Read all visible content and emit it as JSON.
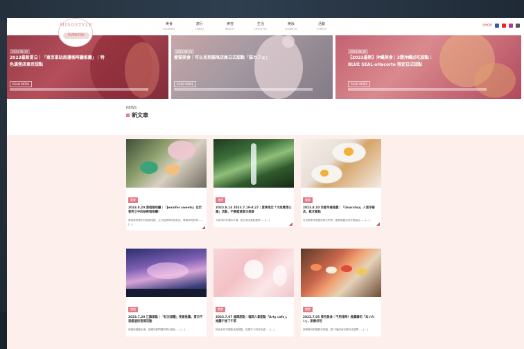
{
  "site": {
    "logo_text": "MISOSTYLE",
    "logo_sub": "EVERYDA",
    "nav": [
      {
        "label": "美食",
        "sub": "GOURMET"
      },
      {
        "label": "旅行",
        "sub": "TRAVEL"
      },
      {
        "label": "美容",
        "sub": "BEAUTY"
      },
      {
        "label": "生活",
        "sub": "LIFESTYLE"
      },
      {
        "label": "美妝",
        "sub": "COSMETIC"
      },
      {
        "label": "活動",
        "sub": "EVENTS"
      }
    ],
    "social_label": "SHOP"
  },
  "slider": {
    "slides": [
      {
        "tag": "2023.08.10",
        "title": "2023最新夏日｜「東京車站周邊咖啡廳推薦」｜特色漢堡店東京甜點",
        "more": "READ MORE"
      },
      {
        "tag": "2023.08.10",
        "title": "愛猫美食｜可以見到貓咪店員日式甜點「猫カフェ」",
        "more": "READ MORE"
      },
      {
        "tag": "2023.08.10",
        "title": "【2023最新】沖縄美食｜3間沖縄必吃甜點｜BLUE SEAL‧oHacorte 限定日式甜點",
        "more": "READ MORE"
      }
    ]
  },
  "news": {
    "eyebrow": "NEWS",
    "title": "新文章",
    "cards": [
      {
        "category": "美食",
        "title": "2023.8.20 原宿咖啡廳｜「Jennifer sweets」位於巷弄之中的秘密咖啡廳！",
        "excerpt": "原宿巷弄裡的可愛咖啡廳，主打鬆餅與特色飲品，環境明亮舒適……[…]"
      },
      {
        "category": "旅遊",
        "title": "2023.8.14 2023.7.19-8.27｜夏季限定「大阪萬博公園」活動，不要錯過夏日美景",
        "excerpt": "大阪郊外的瀑布步道，夏日清涼景點推薦……[…]"
      },
      {
        "category": "美食",
        "title": "2023.8.10 京都早餐推薦｜「Unarutsu」人氣早餐店，歐式餐點",
        "excerpt": "在京都享用豐盛的歐式早餐，雞蛋與麵包的完美組合……[…]"
      },
      {
        "category": "旅遊",
        "title": "2023.7.20 江蘇景點｜「紅光燈籠」夜景推薦，夏日不容錯過的夜間活動",
        "excerpt": "夜晚的燈籠步道，如銀河般閃耀的夢幻景色……[…]"
      },
      {
        "category": "美食",
        "title": "2023.7.07 福岡甜點｜福岡人氣甜點「Arty cafe」，推薦午後下午茶",
        "excerpt": "粉色系的可愛飲品與甜點，拍照打卡的好去處……[…]"
      },
      {
        "category": "美食",
        "title": "2023.7.05 東京美食｜不用排隊！推薦壽司「あいれい」，新鮮好吃",
        "excerpt": "新鮮美味的握壽司拼盤，高CP值的東京壽司店推薦……[…]"
      }
    ]
  },
  "colors": {
    "accent": "#e37b86",
    "news_bg": "#fcefec"
  }
}
